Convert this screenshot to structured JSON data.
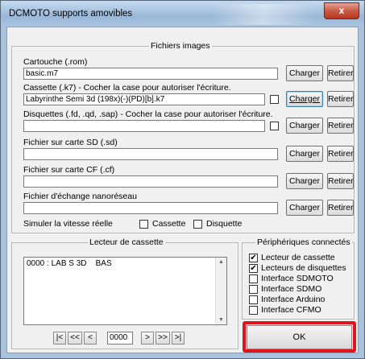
{
  "window": {
    "title": "DCMOTO supports amovibles",
    "close_glyph": "x"
  },
  "images_group": {
    "title": "Fichiers images",
    "load_label": "Charger",
    "remove_label": "Retirer",
    "cartridge": {
      "label": "Cartouche (.rom)",
      "value": "basic.m7"
    },
    "cassette": {
      "label": "Cassette (.k7) - Cocher la case pour autoriser l'écriture.",
      "value": "Labyrinthe Semi 3d (198x)(-)(PD)[b].k7",
      "write_enabled": false
    },
    "floppy": {
      "label": "Disquettes (.fd, .qd, .sap) - Cocher la case pour autoriser l'écriture.",
      "value": "",
      "write_enabled": false
    },
    "sd": {
      "label": "Fichier sur carte SD (.sd)",
      "value": ""
    },
    "cf": {
      "label": "Fichier sur carte CF (.cf)",
      "value": ""
    },
    "nano": {
      "label": "Fichier d'échange nanoréseau",
      "value": ""
    },
    "simulate_label": "Simuler la vitesse réelle",
    "sim_cassette": {
      "label": "Cassette",
      "checked": false
    },
    "sim_disk": {
      "label": "Disquette",
      "checked": false
    }
  },
  "cassette_reader": {
    "title": "Lecteur de cassette",
    "entries": [
      "0000 : LAB S 3D    BAS"
    ],
    "nav": {
      "first": "|<",
      "prev_fast": "<<",
      "prev": "<",
      "position": "0000",
      "next": ">",
      "next_fast": ">>",
      "last": ">|"
    }
  },
  "devices": {
    "title": "Périphériques connectés",
    "items": [
      {
        "label": "Lecteur de cassette",
        "checked": true
      },
      {
        "label": "Lecteurs de disquettes",
        "checked": true
      },
      {
        "label": "Interface SDMOTO",
        "checked": false
      },
      {
        "label": "Interface SDMO",
        "checked": false
      },
      {
        "label": "Interface Arduino",
        "checked": false
      },
      {
        "label": "Interface CFMO",
        "checked": false
      }
    ]
  },
  "ok_label": "OK",
  "check_glyph": "✔",
  "colors": {
    "highlight": "#e0141b",
    "titlebar": "#a9c4e1"
  }
}
